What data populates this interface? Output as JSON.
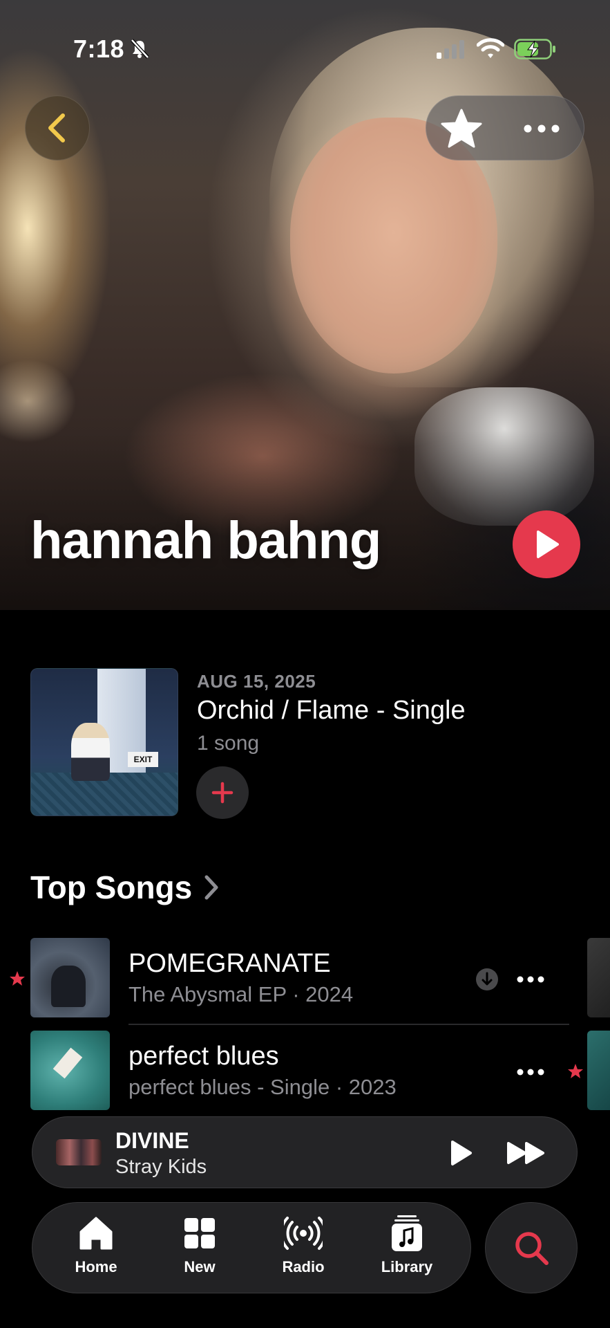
{
  "status_bar": {
    "time": "7:18"
  },
  "artist": {
    "name": "hannah bahng"
  },
  "latest_release": {
    "date": "AUG 15, 2025",
    "title": "Orchid / Flame - Single",
    "count": "1 song"
  },
  "top_songs": {
    "title": "Top Songs",
    "items": [
      {
        "title": "POMEGRANATE",
        "subtitle": "The Abysmal EP · 2024",
        "favorited": true,
        "downloaded": true
      },
      {
        "title": "perfect blues",
        "subtitle": "perfect blues - Single · 2023",
        "favorited": false,
        "downloaded": false
      }
    ]
  },
  "now_playing": {
    "title": "DIVINE",
    "artist": "Stray Kids"
  },
  "tabs": [
    {
      "label": "Home",
      "icon": "house-icon"
    },
    {
      "label": "New",
      "icon": "grid-icon"
    },
    {
      "label": "Radio",
      "icon": "radio-icon"
    },
    {
      "label": "Library",
      "icon": "library-icon"
    }
  ],
  "colors": {
    "accent": "#e5394d",
    "secondary_text": "#8e8e93",
    "background": "#000000"
  }
}
